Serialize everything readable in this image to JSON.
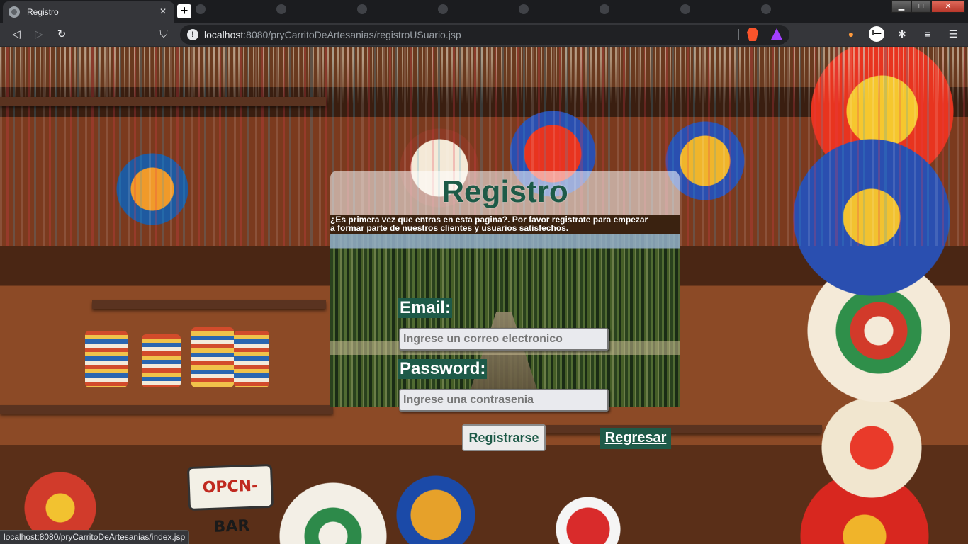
{
  "browser": {
    "active_tab": {
      "title": "Registro",
      "close": "×"
    },
    "new_tab": "+",
    "window_controls": {
      "minimize": "▁",
      "maximize": "□",
      "close": "✕"
    },
    "nav": {
      "back": "◁",
      "forward": "▷",
      "reload": "↻",
      "bookmark": "⛉"
    },
    "address": {
      "host": "localhost",
      "rest": ":8080/pryCarritoDeArtesanias/registroUSuario.jsp",
      "info_icon": "!"
    },
    "extensions": [
      "fox-icon",
      "profile-icon",
      "puzzle-icon",
      "media-icon",
      "menu-icon"
    ],
    "status_url": "localhost:8080/pryCarritoDeArtesanias/index.jsp"
  },
  "form": {
    "title": "Registro",
    "intro_line1": "¿Es primera vez que entras en esta pagina?. Por favor registrate para empezar",
    "intro_line2": "a formar parte de nuestros clientes y usuarios satisfechos.",
    "email_label": "Email:",
    "email_placeholder": "Ingrese un correo electronico",
    "password_label": "Password:",
    "password_placeholder": "Ingrese una contrasenia",
    "submit": "Registrarse",
    "back": "Regresar"
  },
  "colors": {
    "accent": "#1e5a48",
    "title": "#1d5a47",
    "intro_bg": "#3a2210"
  },
  "background_sign": {
    "text_a": "OPCN-",
    "text_b": "BAR"
  }
}
